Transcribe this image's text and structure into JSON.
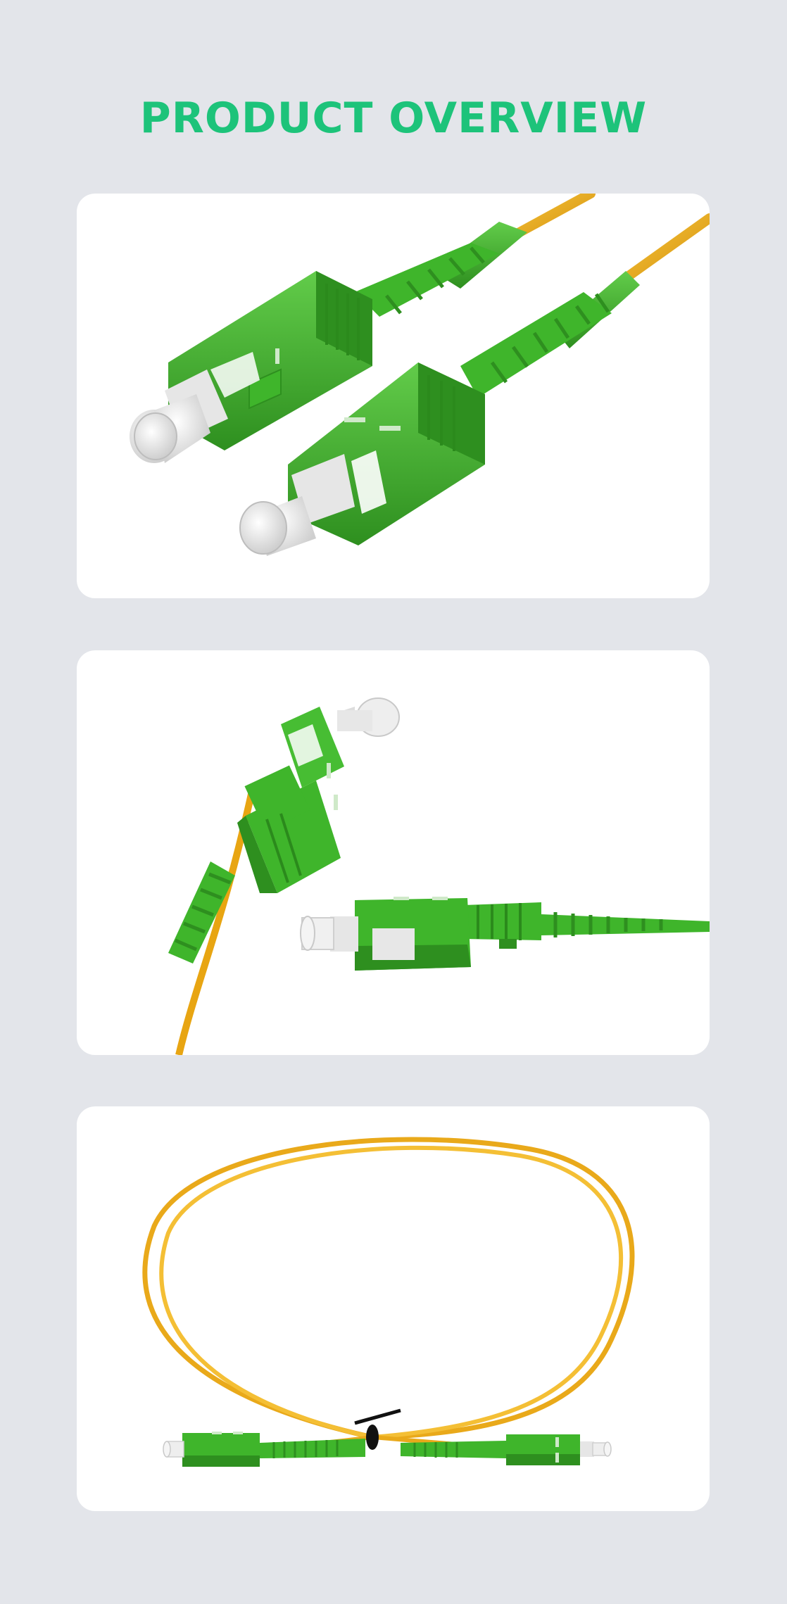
{
  "page": {
    "title": "PRODUCT OVERVIEW"
  },
  "colors": {
    "background": "#e3e5ea",
    "title": "#1dc37a",
    "card": "#ffffff",
    "connector_green": "#3fb52b",
    "connector_green_dark": "#2e8f1f",
    "connector_green_light": "#62cc4a",
    "cable_yellow": "#f2b01e",
    "cable_yellow_dark": "#d4920f",
    "ferrule_white": "#eeeeee",
    "ferrule_shade": "#c9c9c9"
  },
  "product_images": [
    {
      "id": "connector-pair-closeup"
    },
    {
      "id": "connector-pair-angled"
    },
    {
      "id": "coiled-patch-cord"
    }
  ]
}
